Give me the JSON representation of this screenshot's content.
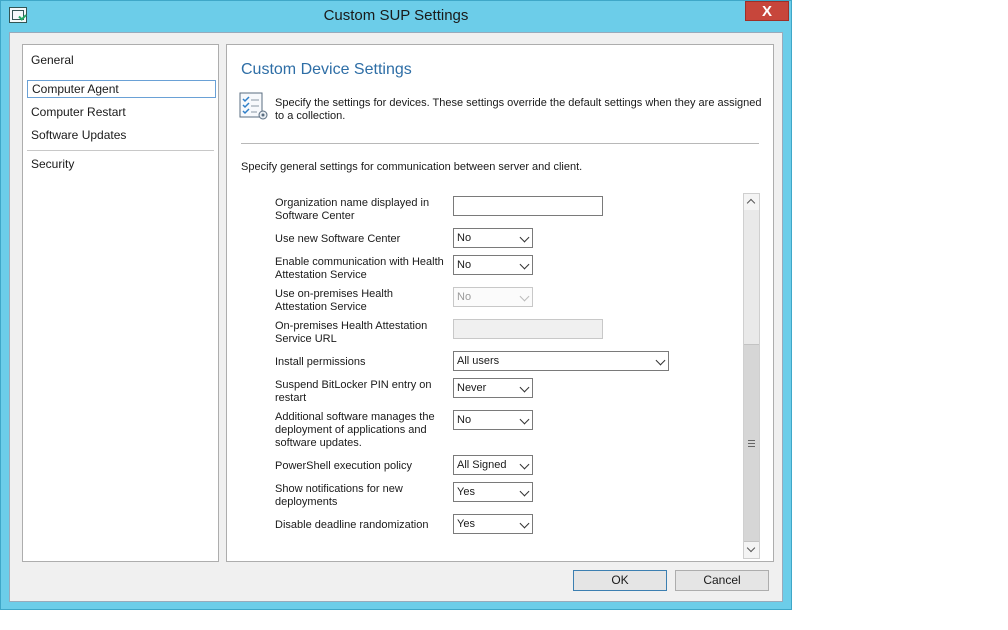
{
  "window": {
    "title": "Custom SUP Settings",
    "close_label": "X"
  },
  "nav": {
    "items": [
      {
        "label": "General"
      },
      {
        "label": "Computer Agent",
        "selected": true
      },
      {
        "label": "Computer Restart"
      },
      {
        "label": "Software Updates"
      },
      {
        "label": "Security"
      }
    ]
  },
  "main": {
    "title": "Custom Device Settings",
    "description": "Specify the settings for devices. These settings override the default settings when they are assigned to a collection.",
    "general_description": "Specify general settings for communication between server and client."
  },
  "settings": [
    {
      "label": "Organization name displayed in Software Center",
      "control": "text",
      "value": ""
    },
    {
      "label": "Use new Software Center",
      "control": "select",
      "value": "No"
    },
    {
      "label": "Enable communication with Health Attestation Service",
      "control": "select",
      "value": "No"
    },
    {
      "label": "Use on-premises Health Attestation Service",
      "control": "select",
      "value": "No",
      "disabled": true
    },
    {
      "label": "On-premises Health Attestation Service URL",
      "control": "text",
      "value": "",
      "disabled": true
    },
    {
      "label": "Install permissions",
      "control": "select",
      "value": "All users"
    },
    {
      "label": "Suspend BitLocker PIN entry on restart",
      "control": "select",
      "value": "Never"
    },
    {
      "label": "Additional software manages the deployment of applications and software updates.",
      "control": "select",
      "value": "No"
    },
    {
      "label": "PowerShell execution policy",
      "control": "select",
      "value": "All Signed"
    },
    {
      "label": "Show notifications for new deployments",
      "control": "select",
      "value": "Yes"
    },
    {
      "label": "Disable deadline randomization",
      "control": "select",
      "value": "Yes"
    }
  ],
  "buttons": {
    "ok": "OK",
    "cancel": "Cancel"
  },
  "colors": {
    "window_frame": "#6ccde9",
    "title_accent": "#2e6ea6",
    "close_button": "#c7463b"
  }
}
